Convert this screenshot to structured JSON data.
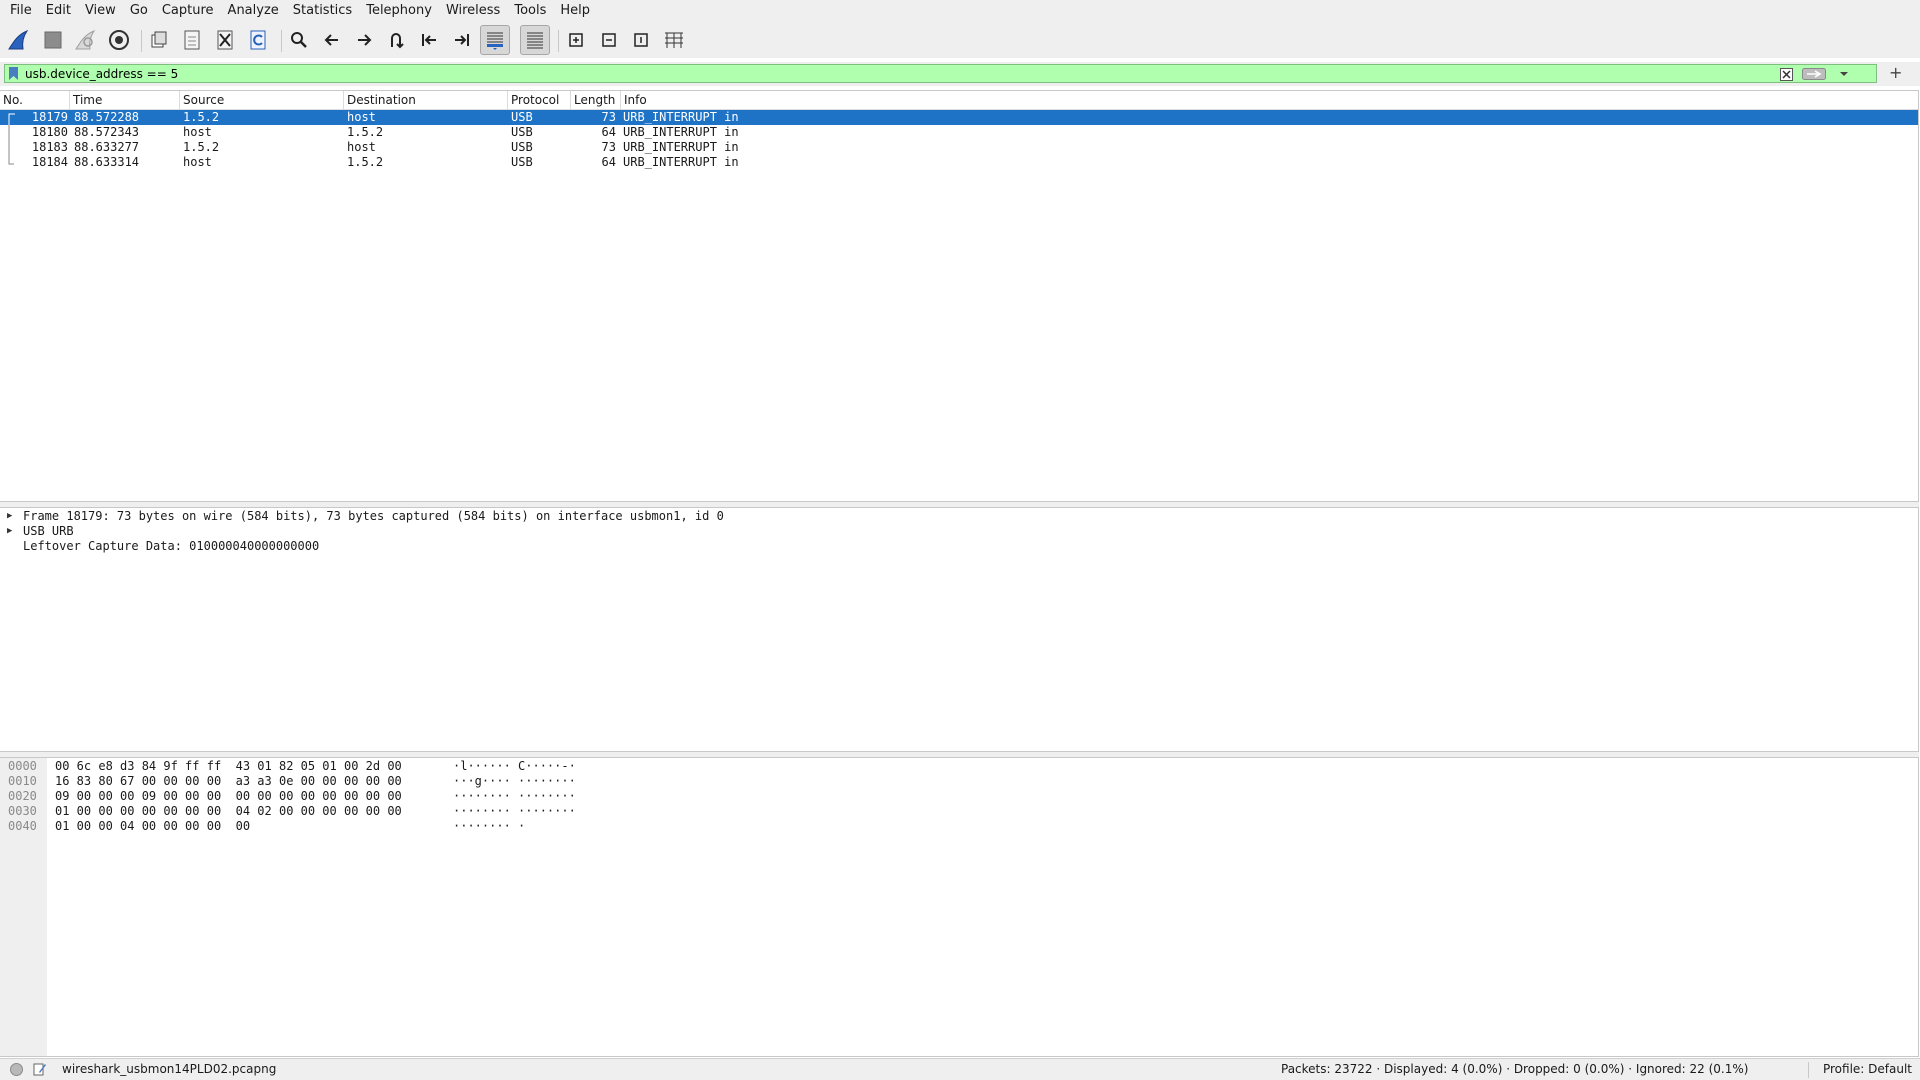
{
  "menu": [
    "File",
    "Edit",
    "View",
    "Go",
    "Capture",
    "Analyze",
    "Statistics",
    "Telephony",
    "Wireless",
    "Tools",
    "Help"
  ],
  "toolbar": {
    "icons": [
      "start-capture-icon",
      "stop-capture-icon",
      "restart-capture-icon",
      "capture-options-icon",
      "open-file-icon",
      "save-file-icon",
      "close-file-icon",
      "reload-file-icon",
      "find-packet-icon",
      "go-back-icon",
      "go-forward-icon",
      "go-to-packet-icon",
      "first-packet-icon",
      "last-packet-icon",
      "auto-scroll-icon",
      "colorize-icon",
      "zoom-in-icon",
      "zoom-out-icon",
      "normal-size-icon",
      "resize-columns-icon"
    ]
  },
  "filter": {
    "value": "usb.device_address == 5",
    "add_label": "+"
  },
  "packet_list": {
    "columns": [
      "No.",
      "Time",
      "Source",
      "Destination",
      "Protocol",
      "Length",
      "Info"
    ],
    "rows": [
      {
        "no": "18179",
        "time": "88.572288",
        "source": "1.5.2",
        "destination": "host",
        "protocol": "USB",
        "length": "73",
        "info": "URB_INTERRUPT in",
        "selected": true
      },
      {
        "no": "18180",
        "time": "88.572343",
        "source": "host",
        "destination": "1.5.2",
        "protocol": "USB",
        "length": "64",
        "info": "URB_INTERRUPT in",
        "selected": false
      },
      {
        "no": "18183",
        "time": "88.633277",
        "source": "1.5.2",
        "destination": "host",
        "protocol": "USB",
        "length": "73",
        "info": "URB_INTERRUPT in",
        "selected": false
      },
      {
        "no": "18184",
        "time": "88.633314",
        "source": "host",
        "destination": "1.5.2",
        "protocol": "USB",
        "length": "64",
        "info": "URB_INTERRUPT in",
        "selected": false
      }
    ]
  },
  "details": [
    {
      "text": "Frame 18179: 73 bytes on wire (584 bits), 73 bytes captured (584 bits) on interface usbmon1, id 0",
      "expandable": true
    },
    {
      "text": "USB URB",
      "expandable": true
    },
    {
      "text": "Leftover Capture Data: 010000040000000000",
      "expandable": false
    }
  ],
  "bytes": [
    {
      "offset": "0000",
      "hex": "00 6c e8 d3 84 9f ff ff  43 01 82 05 01 00 2d 00",
      "ascii": "·l······ C·····-·"
    },
    {
      "offset": "0010",
      "hex": "16 83 80 67 00 00 00 00  a3 a3 0e 00 00 00 00 00",
      "ascii": "···g···· ········"
    },
    {
      "offset": "0020",
      "hex": "09 00 00 00 09 00 00 00  00 00 00 00 00 00 00 00",
      "ascii": "········ ········"
    },
    {
      "offset": "0030",
      "hex": "01 00 00 00 00 00 00 00  04 02 00 00 00 00 00 00",
      "ascii": "········ ········"
    },
    {
      "offset": "0040",
      "hex": "01 00 00 04 00 00 00 00  00",
      "ascii": "········ ·"
    }
  ],
  "status": {
    "file": "wireshark_usbmon14PLD02.pcapng",
    "stats": "Packets: 23722 · Displayed: 4 (0.0%) · Dropped: 0 (0.0%) · Ignored: 22 (0.1%)",
    "profile": "Profile: Default"
  },
  "colors": {
    "filter_valid": "#afffaf",
    "selection": "#1f73c6",
    "chrome": "#efefef"
  }
}
